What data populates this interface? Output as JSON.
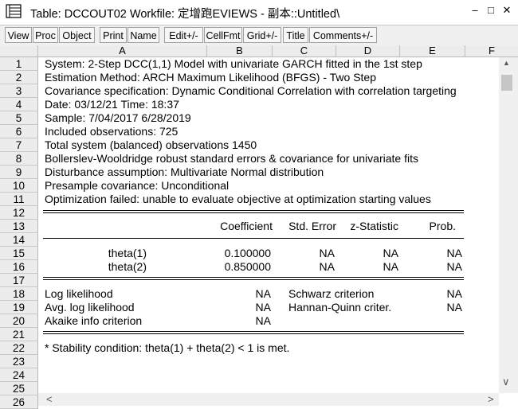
{
  "window": {
    "title": "Table: DCCOUT02   Workfile: 定增跑EVIEWS - 副本::Untitled\\",
    "minimize_glyph": "–",
    "restore_glyph": "□",
    "close_glyph": "✕"
  },
  "toolbar": [
    {
      "label": "View",
      "name": "view-button"
    },
    {
      "label": "Proc",
      "name": "proc-button"
    },
    {
      "label": "Object",
      "name": "object-button"
    },
    {
      "label": "Print",
      "name": "print-button"
    },
    {
      "label": "Name",
      "name": "name-button"
    },
    {
      "label": "Edit+/-",
      "name": "edit-button"
    },
    {
      "label": "CellFmt",
      "name": "cellfmt-button"
    },
    {
      "label": "Grid+/-",
      "name": "grid-button"
    },
    {
      "label": "Title",
      "name": "title-button"
    },
    {
      "label": "Comments+/-",
      "name": "comments-button"
    }
  ],
  "columns": [
    "A",
    "B",
    "C",
    "D",
    "E",
    "F"
  ],
  "rows": [
    "1",
    "2",
    "3",
    "4",
    "5",
    "6",
    "7",
    "8",
    "9",
    "10",
    "11",
    "12",
    "13",
    "14",
    "15",
    "16",
    "17",
    "18",
    "19",
    "20",
    "21",
    "22",
    "23",
    "24",
    "25",
    "26"
  ],
  "header_lines": [
    "System: 2-Step DCC(1,1) Model with univariate GARCH fitted in the 1st step",
    "Estimation Method: ARCH Maximum Likelihood (BFGS) - Two Step",
    "Covariance specification: Dynamic Conditional Correlation with correlation targeting",
    "Date: 03/12/21   Time: 18:37",
    "Sample: 7/04/2017 6/28/2019",
    "Included observations: 725",
    "Total system (balanced) observations 1450",
    "Bollerslev-Wooldridge robust standard errors & covariance for univariate fits",
    "Disturbance assumption: Multivariate Normal distribution",
    "Presample covariance: Unconditional",
    "Optimization failed: unable to evaluate objective at optimization starting values"
  ],
  "coef_table": {
    "headers": [
      "Coefficient",
      "Std. Error",
      "z-Statistic",
      "Prob."
    ],
    "rows": [
      {
        "name": "theta(1)",
        "coef": "0.100000",
        "se": "NA",
        "z": "NA",
        "p": "NA"
      },
      {
        "name": "theta(2)",
        "coef": "0.850000",
        "se": "NA",
        "z": "NA",
        "p": "NA"
      }
    ]
  },
  "stats": [
    {
      "label": "Log likelihood",
      "value": "NA",
      "label2": "Schwarz criterion",
      "value2": "NA"
    },
    {
      "label": "Avg. log likelihood",
      "value": "NA",
      "label2": "Hannan-Quinn criter.",
      "value2": "NA"
    },
    {
      "label": "Akaike info criterion",
      "value": "NA",
      "label2": "",
      "value2": ""
    }
  ],
  "footnote": "* Stability condition: theta(1) + theta(2) < 1 is met.",
  "scroll": {
    "up": "▲",
    "down": "∨",
    "left": "<",
    "right": ">"
  }
}
